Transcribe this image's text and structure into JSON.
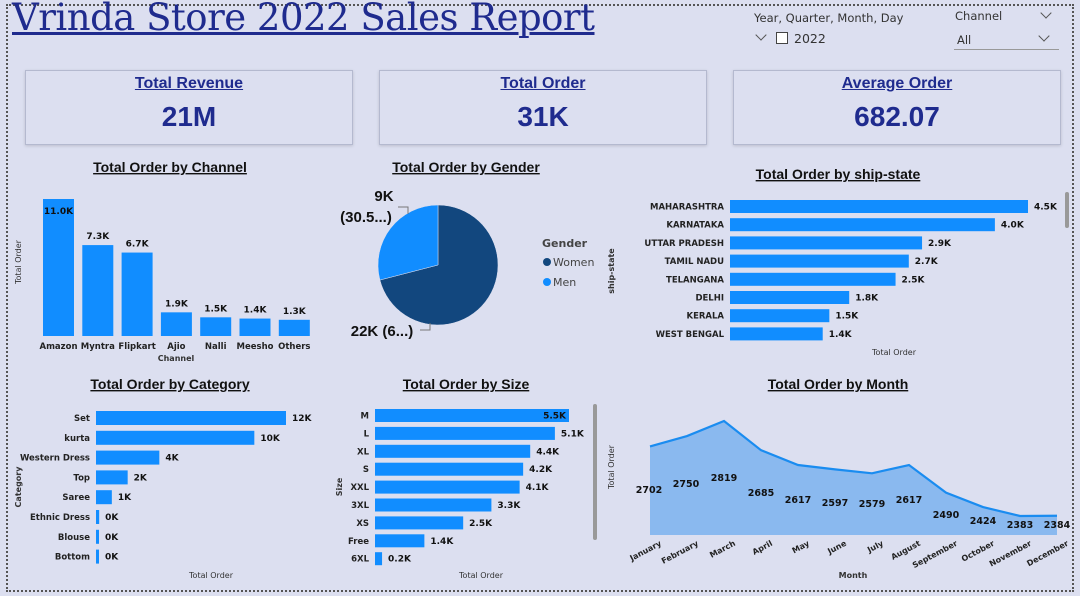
{
  "title": "Vrinda Store 2022 Sales Report",
  "slicers": {
    "date_label": "Year, Quarter, Month, Day",
    "date_value": "2022",
    "channel_label": "Channel",
    "channel_value": "All"
  },
  "cards": [
    {
      "label": "Total Revenue",
      "value": "21M"
    },
    {
      "label": "Total Order",
      "value": "31K"
    },
    {
      "label": "Average Order",
      "value": "682.07"
    }
  ],
  "colors": {
    "bar": "#118dff",
    "dark": "#12477e",
    "area": "#8ab9ef",
    "line": "#1a8cf0"
  },
  "chart_data": [
    {
      "type": "bar",
      "title": "Total Order by Channel",
      "xlabel": "Channel",
      "ylabel": "Total Order",
      "categories": [
        "Amazon",
        "Myntra",
        "Flipkart",
        "Ajio",
        "Nalli",
        "Meesho",
        "Others"
      ],
      "values": [
        11.0,
        7.3,
        6.7,
        1.9,
        1.5,
        1.4,
        1.3
      ],
      "data_labels": [
        "11.0K",
        "7.3K",
        "6.7K",
        "1.9K",
        "1.5K",
        "1.4K",
        "1.3K"
      ]
    },
    {
      "type": "pie",
      "title": "Total Order by Gender",
      "legend_title": "Gender",
      "categories": [
        "Women",
        "Men"
      ],
      "values": [
        22,
        9
      ],
      "data_labels": [
        "22K (6...)",
        "9K (30.5...)"
      ]
    },
    {
      "type": "bar",
      "title": "Total Order by ship-state",
      "xlabel": "Total Order",
      "ylabel": "ship-state",
      "categories": [
        "MAHARASHTRA",
        "KARNATAKA",
        "UTTAR PRADESH",
        "TAMIL NADU",
        "TELANGANA",
        "DELHI",
        "KERALA",
        "WEST BENGAL"
      ],
      "values": [
        4.5,
        4.0,
        2.9,
        2.7,
        2.5,
        1.8,
        1.5,
        1.4
      ],
      "data_labels": [
        "4.5K",
        "4.0K",
        "2.9K",
        "2.7K",
        "2.5K",
        "1.8K",
        "1.5K",
        "1.4K"
      ]
    },
    {
      "type": "bar",
      "title": "Total Order by Category",
      "xlabel": "Total Order",
      "ylabel": "Category",
      "categories": [
        "Set",
        "kurta",
        "Western Dress",
        "Top",
        "Saree",
        "Ethnic Dress",
        "Blouse",
        "Bottom"
      ],
      "values": [
        12,
        10,
        4,
        2,
        1,
        0.2,
        0.1,
        0.05
      ],
      "data_labels": [
        "12K",
        "10K",
        "4K",
        "2K",
        "1K",
        "0K",
        "0K",
        "0K"
      ]
    },
    {
      "type": "bar",
      "title": "Total Order by Size",
      "xlabel": "Total Order",
      "ylabel": "Size",
      "categories": [
        "M",
        "L",
        "XL",
        "S",
        "XXL",
        "3XL",
        "XS",
        "Free",
        "6XL"
      ],
      "values": [
        5.5,
        5.1,
        4.4,
        4.2,
        4.1,
        3.3,
        2.5,
        1.4,
        0.2
      ],
      "data_labels": [
        "5.5K",
        "5.1K",
        "4.4K",
        "4.2K",
        "4.1K",
        "3.3K",
        "2.5K",
        "1.4K",
        "0.2K"
      ]
    },
    {
      "type": "area",
      "title": "Total Order by Month",
      "xlabel": "Month",
      "ylabel": "Total Order",
      "categories": [
        "January",
        "February",
        "March",
        "April",
        "May",
        "June",
        "July",
        "August",
        "September",
        "October",
        "November",
        "December"
      ],
      "values": [
        2702,
        2750,
        2819,
        2685,
        2617,
        2597,
        2579,
        2617,
        2490,
        2424,
        2383,
        2384
      ]
    }
  ]
}
